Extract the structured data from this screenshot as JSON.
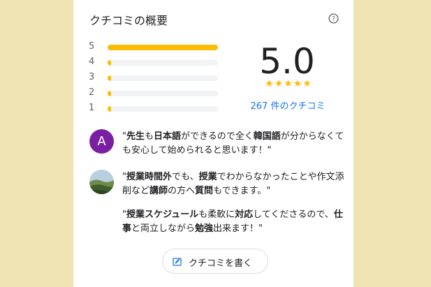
{
  "title": "クチコミの概要",
  "rating": {
    "score": "5.0",
    "stars": "★★★★★",
    "review_count": "267 件のクチコミ",
    "star_color": "#fbbc04"
  },
  "distribution": [
    {
      "label": "5",
      "fraction": 1.0
    },
    {
      "label": "4",
      "fraction": 0.03
    },
    {
      "label": "3",
      "fraction": 0.02
    },
    {
      "label": "2",
      "fraction": 0.02
    },
    {
      "label": "1",
      "fraction": 0.02
    }
  ],
  "reviews": [
    {
      "avatar_letter": "A",
      "avatar_color": "#7b1fa2",
      "segments": [
        {
          "t": "\"",
          "b": false
        },
        {
          "t": "先生",
          "b": true
        },
        {
          "t": "も",
          "b": false
        },
        {
          "t": "日本語",
          "b": true
        },
        {
          "t": "ができるので全く",
          "b": false
        },
        {
          "t": "韓国語",
          "b": true
        },
        {
          "t": "が分からなくても安心して始められると思います！\"",
          "b": false
        }
      ]
    },
    {
      "avatar_type": "photo",
      "segments": [
        {
          "t": "\"",
          "b": false
        },
        {
          "t": "授業時間外",
          "b": true
        },
        {
          "t": "でも、",
          "b": false
        },
        {
          "t": "授業",
          "b": true
        },
        {
          "t": "でわからなかったことや作文添削など",
          "b": false
        },
        {
          "t": "講師",
          "b": true
        },
        {
          "t": "の方へ",
          "b": false
        },
        {
          "t": "質問",
          "b": true
        },
        {
          "t": "もできます。\"",
          "b": false
        }
      ]
    },
    {
      "avatar_type": "none",
      "segments": [
        {
          "t": "\"",
          "b": false
        },
        {
          "t": "授業スケジュール",
          "b": true
        },
        {
          "t": "も柔軟に",
          "b": false
        },
        {
          "t": "対応",
          "b": true
        },
        {
          "t": "してくださるので、",
          "b": false
        },
        {
          "t": "仕事",
          "b": true
        },
        {
          "t": "と両立しながら",
          "b": false
        },
        {
          "t": "勉強",
          "b": true
        },
        {
          "t": "出来ます！\"",
          "b": false
        }
      ]
    }
  ],
  "write_button": {
    "label": "クチコミを書く",
    "icon": "edit-review-icon"
  },
  "icons": {
    "help": "help-circle-icon"
  },
  "colors": {
    "background": "#efe3b3",
    "accent": "#1a73e8"
  }
}
